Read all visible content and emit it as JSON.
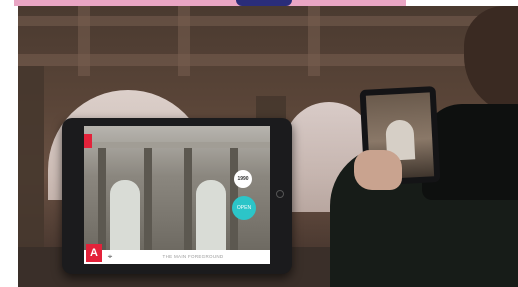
{
  "app": {
    "red_tag_label": "≡",
    "logo_letter": "A",
    "icon_name_logo": "brand-logo-icon",
    "caption": "THE MAIN FOREGROUND",
    "date_badge": "1990",
    "action_label": "OPEN",
    "small_icon": "⌖"
  },
  "colors": {
    "brand_red": "#e3223a",
    "accent_teal": "#2cc5c8"
  }
}
